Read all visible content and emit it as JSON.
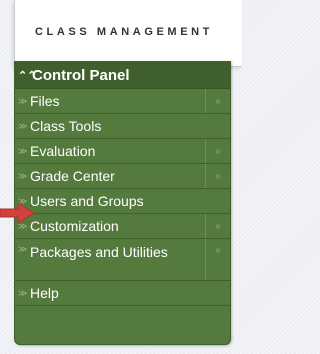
{
  "tab": {
    "title": "CLASS MANAGEMENT"
  },
  "panel": {
    "title": "Control Panel",
    "collapse_glyph": "≈"
  },
  "menu": {
    "items": [
      {
        "label": "Files",
        "expand_glyph": "≫",
        "submenu_glyph": "»"
      },
      {
        "label": "Class Tools",
        "expand_glyph": "≫"
      },
      {
        "label": "Evaluation",
        "expand_glyph": "≫",
        "submenu_glyph": "»"
      },
      {
        "label": "Grade Center",
        "expand_glyph": "≫",
        "submenu_glyph": "»"
      },
      {
        "label": "Users and Groups",
        "expand_glyph": "≫"
      },
      {
        "label": "Customization",
        "expand_glyph": "≫",
        "submenu_glyph": "»"
      },
      {
        "label": "Packages and Utilities",
        "expand_glyph": "≫",
        "submenu_glyph": "»"
      },
      {
        "label": "Help",
        "expand_glyph": "≫"
      }
    ]
  },
  "colors": {
    "panel_green": "#547a3e",
    "header_green": "#3f602d",
    "arrow_red": "#d0423c"
  },
  "icons": {
    "pointer": "red-arrow-icon"
  }
}
